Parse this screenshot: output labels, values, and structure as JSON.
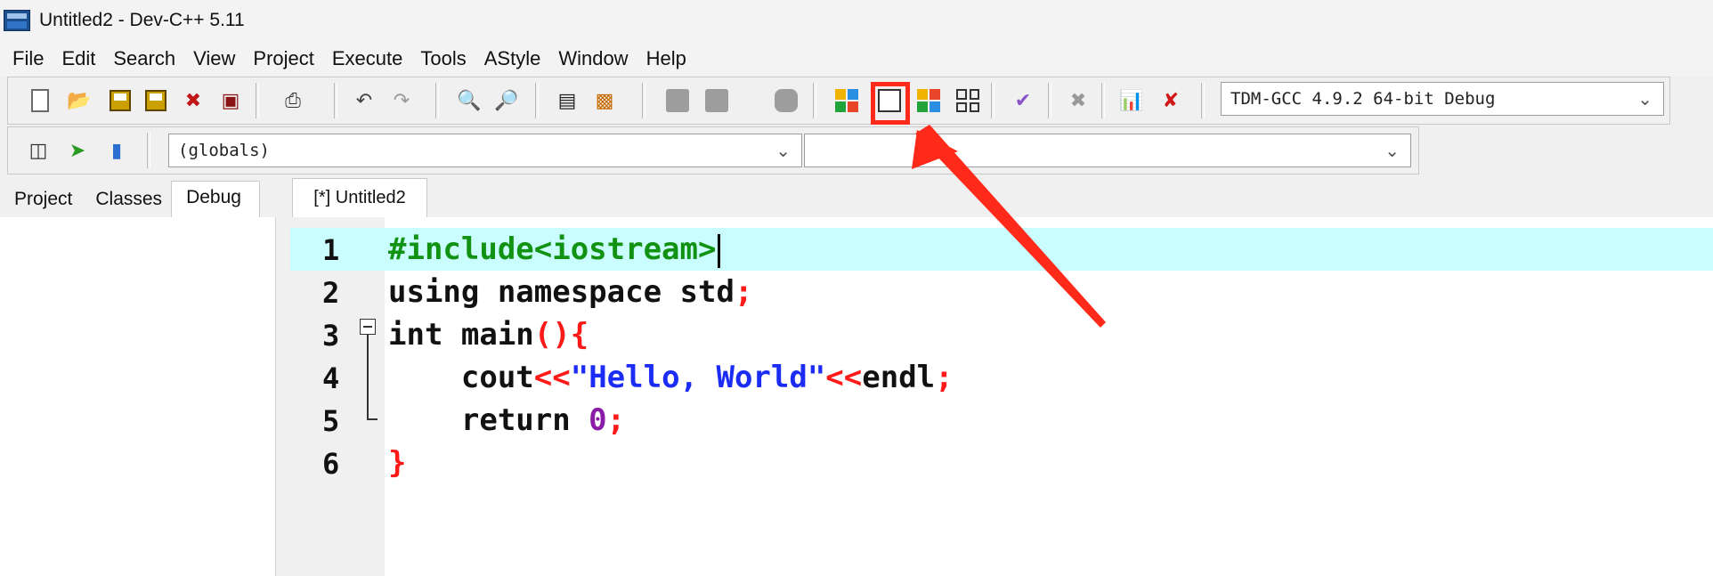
{
  "window": {
    "title": "Untitled2 - Dev-C++ 5.11"
  },
  "menu": [
    "File",
    "Edit",
    "Search",
    "View",
    "Project",
    "Execute",
    "Tools",
    "AStyle",
    "Window",
    "Help"
  ],
  "toolbar": {
    "compiler_select": "TDM-GCC 4.9.2 64-bit Debug",
    "scope_select": "(globals)",
    "member_select": "",
    "icons": [
      "new-file-icon",
      "open-file-icon",
      "save-icon",
      "save-all-icon",
      "close-icon",
      "close-all-icon",
      "print-icon",
      "undo-icon",
      "redo-icon",
      "find-icon",
      "replace-icon",
      "indent-icon",
      "unindent-icon",
      "goto-line-icon",
      "bookmark-icon",
      "breakpoint-icon",
      "compile-icon",
      "run-icon",
      "compile-run-icon",
      "rebuild-icon",
      "syntax-check-icon",
      "stop-icon",
      "chart-icon",
      "debug-icon",
      "new-project-icon",
      "insert-icon",
      "toggle-icon"
    ]
  },
  "left_panel": {
    "tabs": [
      "Project",
      "Classes",
      "Debug"
    ],
    "active_tab": "Debug"
  },
  "editor": {
    "tab_label": "[*] Untitled2",
    "lines": [
      "1",
      "2",
      "3",
      "4",
      "5",
      "6"
    ],
    "code": {
      "l1": "#include<iostream>",
      "l2_kw": "using namespace std",
      "l2_end": ";",
      "l3_kw": "int main",
      "l3_end": "(){",
      "l4_a": "    cout",
      "l4_b": "<<",
      "l4_c": "\"Hello, World\"",
      "l4_d": "<<",
      "l4_e": "endl",
      "l4_f": ";",
      "l5_a": "    return ",
      "l5_b": "0",
      "l5_c": ";",
      "l6": "}"
    }
  },
  "annotation": {
    "highlight_color": "#ff2a1a"
  }
}
